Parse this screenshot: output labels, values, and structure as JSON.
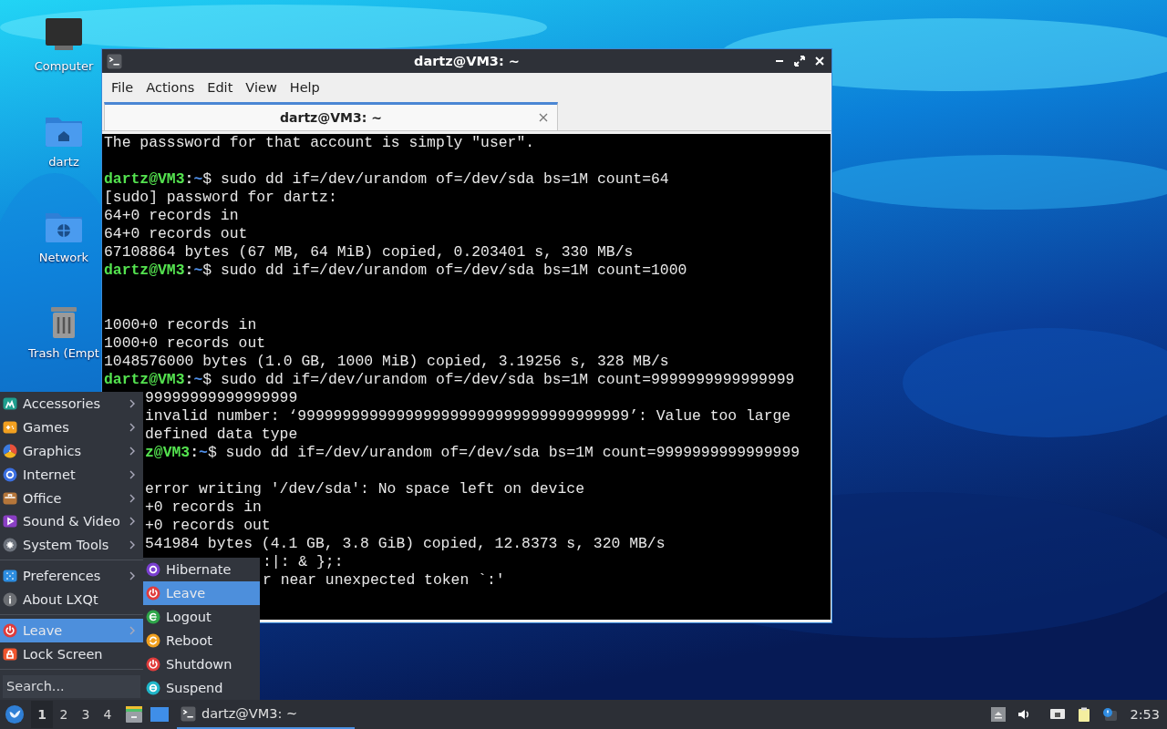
{
  "desktop_icons": [
    {
      "label": "Computer"
    },
    {
      "label": "dartz"
    },
    {
      "label": "Network"
    },
    {
      "label": "Trash (Empt"
    }
  ],
  "window": {
    "title": "dartz@VM3: ~",
    "menu": [
      "File",
      "Actions",
      "Edit",
      "View",
      "Help"
    ],
    "tabs": [
      {
        "label": "dartz@VM3: ~",
        "selected": true
      }
    ],
    "terminal_lines": [
      {
        "kind": "text",
        "text": "The passsword for that account is simply \"user\"."
      },
      {
        "kind": "blank"
      },
      {
        "kind": "prompt",
        "user": "dartz@VM3",
        "sep": ":",
        "path": "~",
        "command": "$ sudo dd if=/dev/urandom of=/dev/sda bs=1M count=64"
      },
      {
        "kind": "text",
        "text": "[sudo] password for dartz:"
      },
      {
        "kind": "text",
        "text": "64+0 records in"
      },
      {
        "kind": "text",
        "text": "64+0 records out"
      },
      {
        "kind": "text",
        "text": "67108864 bytes (67 MB, 64 MiB) copied, 0.203401 s, 330 MB/s"
      },
      {
        "kind": "prompt",
        "user": "dartz@VM3",
        "sep": ":",
        "path": "~",
        "command": "$ sudo dd if=/dev/urandom of=/dev/sda bs=1M count=1000"
      },
      {
        "kind": "blank"
      },
      {
        "kind": "blank"
      },
      {
        "kind": "text",
        "text": "1000+0 records in"
      },
      {
        "kind": "text",
        "text": "1000+0 records out"
      },
      {
        "kind": "text",
        "text": "1048576000 bytes (1.0 GB, 1000 MiB) copied, 3.19256 s, 328 MB/s"
      },
      {
        "kind": "prompt",
        "user": "dartz@VM3",
        "sep": ":",
        "path": "~",
        "command": "$ sudo dd if=/dev/urandom of=/dev/sda bs=1M count=9999999999999999"
      },
      {
        "kind": "partial",
        "text": "99999999999999999"
      },
      {
        "kind": "partial",
        "text": "invalid number: ‘9999999999999999999999999999999999999’: Value too large"
      },
      {
        "kind": "partial",
        "text": "defined data type"
      },
      {
        "kind": "partialprompt",
        "user": "z@VM3",
        "sep": ":",
        "path": "~",
        "command": "$ sudo dd if=/dev/urandom of=/dev/sda bs=1M count=9999999999999999"
      },
      {
        "kind": "blank"
      },
      {
        "kind": "partial",
        "text": "error writing '/dev/sda': No space left on device"
      },
      {
        "kind": "partial",
        "text": "+0 records in"
      },
      {
        "kind": "partial",
        "text": "+0 records out"
      },
      {
        "kind": "partial",
        "text": "541984 bytes (4.1 GB, 3.8 GiB) copied, 12.8373 s, 320 MB/s"
      },
      {
        "kind": "tail",
        "text": ":|: & };:"
      },
      {
        "kind": "tail",
        "text": "r near unexpected token `:'"
      }
    ]
  },
  "app_menu": {
    "items": [
      {
        "kind": "item",
        "label": "Accessories",
        "submenu": true,
        "selected": false
      },
      {
        "kind": "item",
        "label": "Games",
        "submenu": true,
        "selected": false
      },
      {
        "kind": "item",
        "label": "Graphics",
        "submenu": true,
        "selected": false
      },
      {
        "kind": "item",
        "label": "Internet",
        "submenu": true,
        "selected": false
      },
      {
        "kind": "item",
        "label": "Office",
        "submenu": true,
        "selected": false
      },
      {
        "kind": "item",
        "label": "Sound & Video",
        "submenu": true,
        "selected": false
      },
      {
        "kind": "item",
        "label": "System Tools",
        "submenu": true,
        "selected": false
      },
      {
        "kind": "separator"
      },
      {
        "kind": "item",
        "label": "Preferences",
        "submenu": true,
        "selected": false
      },
      {
        "kind": "item",
        "label": "About LXQt",
        "submenu": false,
        "selected": false
      },
      {
        "kind": "separator"
      },
      {
        "kind": "item",
        "label": "Leave",
        "submenu": true,
        "selected": true
      },
      {
        "kind": "item",
        "label": "Lock Screen",
        "submenu": false,
        "selected": false
      },
      {
        "kind": "separator"
      }
    ],
    "search": {
      "placeholder": "Search..."
    }
  },
  "leave_menu": {
    "items": [
      {
        "label": "Hibernate",
        "selected": false
      },
      {
        "label": "Leave",
        "selected": true
      },
      {
        "label": "Logout",
        "selected": false
      },
      {
        "label": "Reboot",
        "selected": false
      },
      {
        "label": "Shutdown",
        "selected": false
      },
      {
        "label": "Suspend",
        "selected": false
      }
    ]
  },
  "taskbar": {
    "desktops": [
      {
        "label": "1",
        "selected": true
      },
      {
        "label": "2",
        "selected": false
      },
      {
        "label": "3",
        "selected": false
      },
      {
        "label": "4",
        "selected": false
      }
    ],
    "tasks": [
      {
        "label": "dartz@VM3: ~",
        "selected": true
      }
    ],
    "clock": "2:53"
  }
}
